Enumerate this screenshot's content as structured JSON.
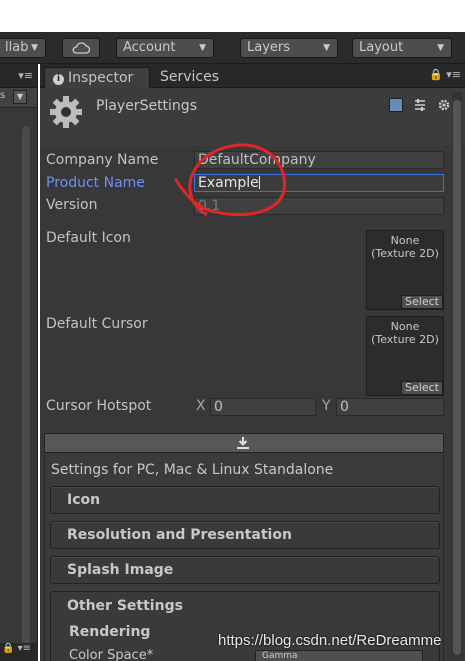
{
  "toolbar": {
    "collab_label": "llab",
    "account_label": "Account",
    "layers_label": "Layers",
    "layout_label": "Layout",
    "cloud_icon": "cloud-icon"
  },
  "leftpanel": {
    "sub_text": "s"
  },
  "inspector": {
    "tabs": [
      {
        "label": "Inspector",
        "active": true
      },
      {
        "label": "Services",
        "active": false
      }
    ],
    "title": "PlayerSettings",
    "fields": {
      "company_label": "Company Name",
      "company_value": "DefaultCompany",
      "product_label": "Product Name",
      "product_value": "Example",
      "version_label": "Version",
      "version_value": "0.1",
      "default_icon_label": "Default Icon",
      "default_cursor_label": "Default Cursor",
      "texture_none": "None",
      "texture_type": "(Texture 2D)",
      "select_label": "Select",
      "hotspot_label": "Cursor Hotspot",
      "hotspot_x_label": "X",
      "hotspot_x": "0",
      "hotspot_y_label": "Y",
      "hotspot_y": "0"
    },
    "settings_for": "Settings for PC, Mac & Linux Standalone",
    "sections": [
      "Icon",
      "Resolution and Presentation",
      "Splash Image"
    ],
    "other_settings": {
      "title": "Other Settings",
      "rendering": "Rendering",
      "color_space_label": "Color Space*",
      "color_space_value": "Gamma"
    }
  },
  "watermark": "https://blog.csdn.net/ReDreamme",
  "colors": {
    "panel_bg": "#383838",
    "accent_blue": "#6f8ff5",
    "focus_border": "#3b6de6",
    "annotation_red": "#e0262b"
  }
}
